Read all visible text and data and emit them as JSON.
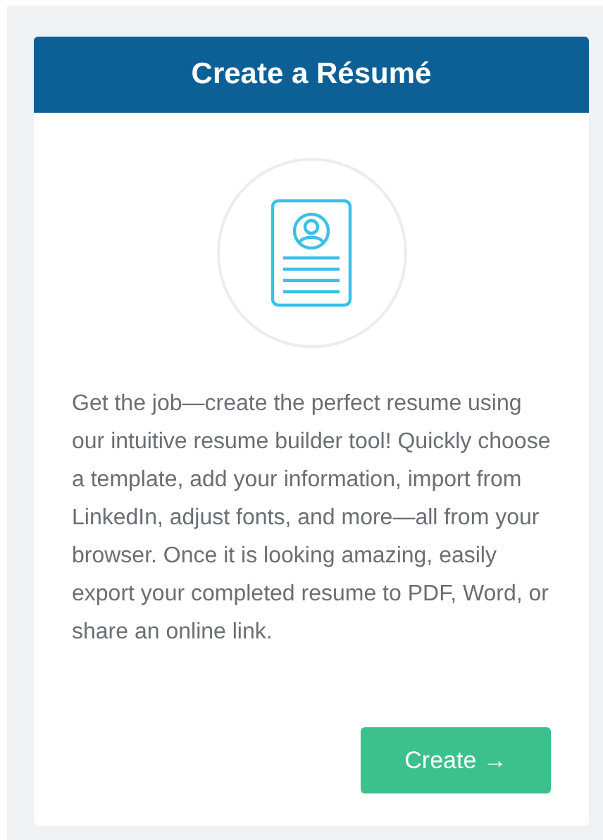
{
  "card": {
    "title": "Create a Résumé",
    "description": "Get the job—create the perfect resume using our intuitive resume builder tool! Quickly choose a template, add your information, import from LinkedIn, adjust fonts, and more—all from your browser. Once it is looking amazing, easily export your completed resume to PDF, Word, or share an online link.",
    "button": "Create →"
  }
}
